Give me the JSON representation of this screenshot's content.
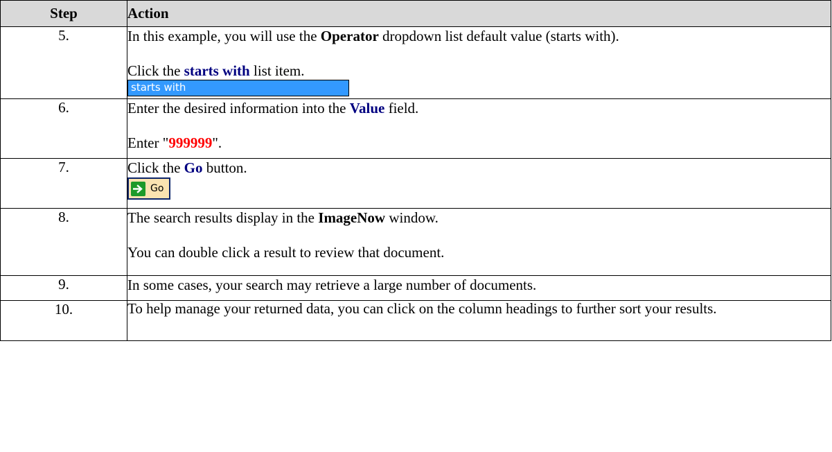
{
  "header": {
    "step": "Step",
    "action": "Action"
  },
  "rows": [
    {
      "step": "5.",
      "line1_pre": "In this example, you will use the ",
      "line1_bold": "Operator",
      "line1_post": " dropdown list default value (starts with).",
      "line2_pre": "Click the ",
      "line2_blue": "starts with",
      "line2_post": " list item.",
      "image_text": "starts with"
    },
    {
      "step": "6.",
      "line1_pre": "Enter the desired information into the ",
      "line1_blue": "Value",
      "line1_post": " field.",
      "line2_pre": "Enter \"",
      "line2_red": "999999",
      "line2_post": "\"."
    },
    {
      "step": "7.",
      "line1_pre": "Click the ",
      "line1_blue": "Go",
      "line1_post": " button.",
      "button_label": "Go"
    },
    {
      "step": "8.",
      "line1_pre": "The search results display in the ",
      "line1_bold": "ImageNow",
      "line1_post": " window.",
      "line2": "You can double click a result to review that document."
    },
    {
      "step": "9.",
      "line1": "In some cases, your search may retrieve a large number of documents."
    },
    {
      "step": "10.",
      "line1": "To help manage your returned data, you can  click on the column headings to further sort your results."
    }
  ],
  "colors": {
    "header_bg": "#d9d9d9",
    "highlight_blue": "#000080",
    "value_red": "#ff0000",
    "selection_blue": "#3399ff",
    "go_icon_green": "#1d9a2a"
  },
  "icons": {
    "go_button_icon": "arrow-right-icon"
  }
}
